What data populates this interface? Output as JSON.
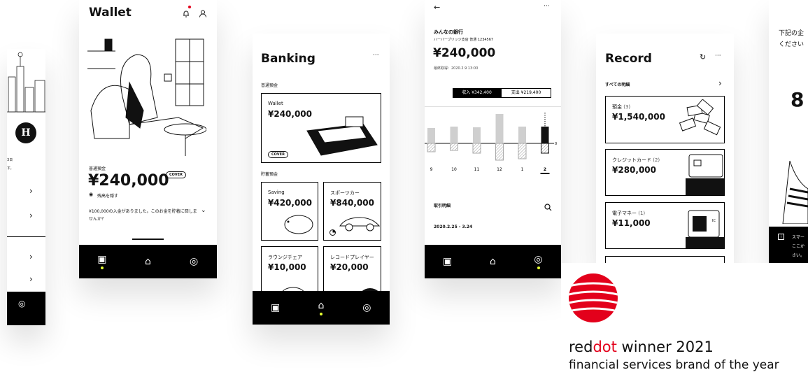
{
  "screen1": {
    "avatar_letter": "H",
    "snippet_a": "3日",
    "snippet_b": "す。",
    "chevron": "›"
  },
  "wallet": {
    "title": "Wallet",
    "account_label": "普通預金",
    "balance": "¥240,000",
    "cover_badge": "COVER",
    "hide_balance": "残高を隠す",
    "message": "¥100,000の入金がありました。このお金を貯着に回しませんか？"
  },
  "banking": {
    "title": "Banking",
    "more": "···",
    "section1": "普通預金",
    "wallet_card": {
      "label": "Wallet",
      "value": "¥240,000",
      "badge": "COVER"
    },
    "section2": "貯蓄預金",
    "savings": [
      {
        "label": "Saving",
        "value": "¥420,000"
      },
      {
        "label": "スポーツカー",
        "value": "¥840,000"
      },
      {
        "label": "ラウンジチェア",
        "value": "¥10,000"
      },
      {
        "label": "レコードプレイヤー",
        "value": "¥20,000"
      }
    ]
  },
  "bank_detail": {
    "back": "←",
    "more": "···",
    "bank_name": "みんなの銀行",
    "branch": "ハーバーブリッジ支店 普通 1234567",
    "balance": "¥240,000",
    "updated": "最終取得：2020.2.9 13:00",
    "income": "収入 ¥342,400",
    "expense": "支出 ¥219,400",
    "history_label": "取引明細",
    "date_range": "2020.2.25 - 3.24",
    "zero_label": "0",
    "chart_data": {
      "type": "bar",
      "categories": [
        "9",
        "10",
        "11",
        "12",
        "1",
        "2"
      ],
      "series": [
        {
          "name": "収入",
          "values": [
            22,
            24,
            23,
            42,
            24,
            24
          ]
        },
        {
          "name": "支出",
          "values": [
            -12,
            -10,
            -14,
            -24,
            -22,
            -14
          ]
        }
      ]
    }
  },
  "record": {
    "title": "Record",
    "all_label": "すべての明細",
    "items": [
      {
        "label": "預金",
        "count": "(3)",
        "value": "¥1,540,000"
      },
      {
        "label": "クレジットカード",
        "count": "(2)",
        "value": "¥280,000"
      },
      {
        "label": "電子マネー",
        "count": "(1)",
        "value": "¥11,000"
      }
    ],
    "ic_label": "IC"
  },
  "screen6": {
    "text1": "下記の企",
    "text2": "ください",
    "big_digit": "8",
    "info_text1": "スマー",
    "info_text2": "ここか",
    "info_text3": "さい。"
  },
  "award": {
    "red": "red",
    "dot": "dot",
    "winner": " winner 2021",
    "subtitle": "financial services brand of the year",
    "brand_color": "#e3001b"
  }
}
